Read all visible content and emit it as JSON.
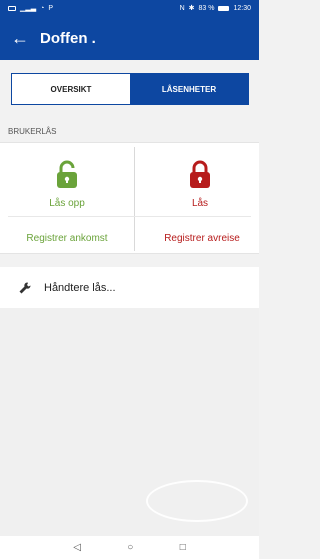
{
  "status": {
    "left_icons": [
      "sim-icon",
      "signal-icon",
      "wifi-icon",
      "p-icon"
    ],
    "right_text": "83 %",
    "time": "12:30"
  },
  "appbar": {
    "back_icon": "arrow-left-icon",
    "title": "Doffen ."
  },
  "tabs": [
    {
      "label": "OVERSIKT",
      "active": false
    },
    {
      "label": "LÅSENHETER",
      "active": true
    }
  ],
  "section_title": "BRUKERLÅS",
  "locks": {
    "open_label": "Lås opp",
    "closed_label": "Lås",
    "register_arrival": "Registrer ankomst",
    "register_departure": "Registrer avreise",
    "open_color": "#6aa33a",
    "closed_color": "#b71c1c"
  },
  "manage": {
    "icon": "wrench-icon",
    "label": "Håndtere lås..."
  },
  "navbar": {
    "back": "◁",
    "home": "○",
    "recents": "□"
  }
}
